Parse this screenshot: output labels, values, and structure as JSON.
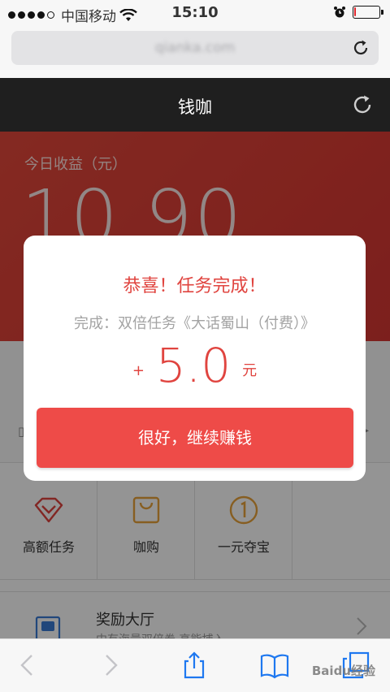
{
  "status_bar": {
    "carrier": "中国移动",
    "time": "15:10",
    "battery_level": 0.08,
    "battery_color": "#e0242b"
  },
  "browser": {
    "url": "qianka.com",
    "reload_icon": "reload-icon"
  },
  "header": {
    "title": "钱咖",
    "refresh_icon": "refresh-icon"
  },
  "earnings": {
    "label": "今日收益（元）",
    "value": "10.90"
  },
  "modal": {
    "title": "恭喜！任务完成！",
    "task": "完成：双倍任务《大话蜀山（付费）》",
    "plus": "+",
    "amount": "5.0",
    "unit": "元",
    "button_label": "很好，继续赚钱"
  },
  "grid": {
    "items": [
      {
        "label": "高额任务",
        "icon": "diamond-icon"
      },
      {
        "label": "咖购",
        "icon": "shopping-bag-icon"
      },
      {
        "label": "一元夺宝",
        "icon": "coin-icon"
      },
      {
        "label": "",
        "icon": ""
      }
    ]
  },
  "reward": {
    "title": "奖励大厅",
    "subtitle": "中有海量双倍券 高能捕入",
    "icon": "reward-hall-icon"
  },
  "toolbar": {
    "icons": [
      "back-icon",
      "forward-icon",
      "share-icon",
      "bookmarks-icon",
      "tabs-icon"
    ],
    "watermark": "Baidu经验"
  },
  "colors": {
    "accent": "#e0443f",
    "button": "#ee4b48",
    "header_bg": "#1f1f1f"
  }
}
